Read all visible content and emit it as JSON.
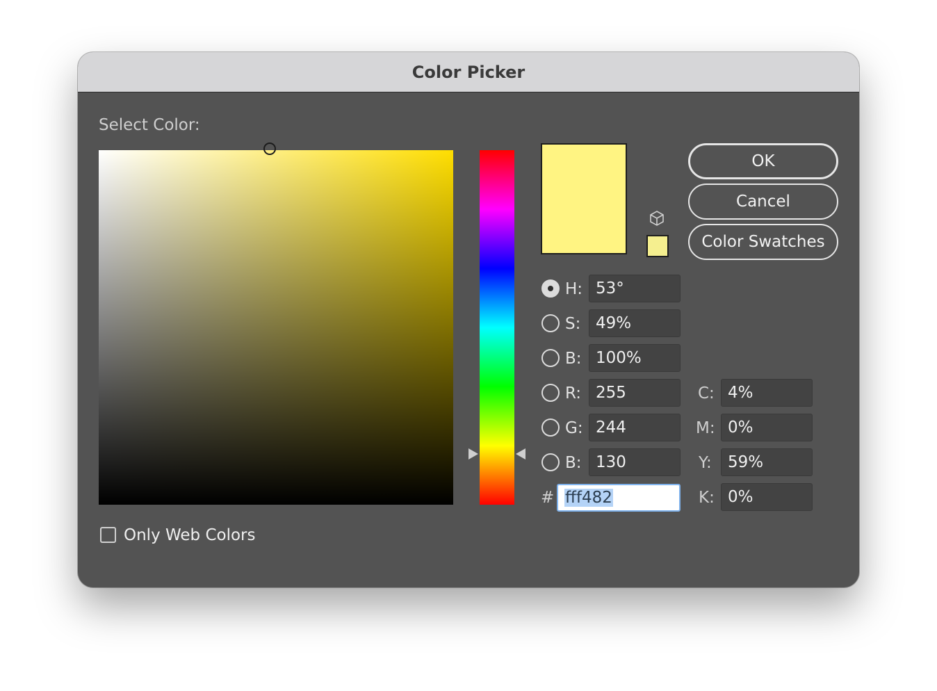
{
  "window": {
    "title": "Color Picker"
  },
  "picker": {
    "select_label": "Select Color:",
    "new_color": "#fff482",
    "current_color": "#f5ef8f",
    "field_hue_color": "#ffde00"
  },
  "buttons": {
    "ok": "OK",
    "cancel": "Cancel",
    "swatches": "Color Swatches"
  },
  "hsb": {
    "h": {
      "label": "H:",
      "value": "53°",
      "selected": true
    },
    "s": {
      "label": "S:",
      "value": "49%",
      "selected": false
    },
    "b": {
      "label": "B:",
      "value": "100%",
      "selected": false
    }
  },
  "rgb": {
    "r": {
      "label": "R:",
      "value": "255",
      "selected": false
    },
    "g": {
      "label": "G:",
      "value": "244",
      "selected": false
    },
    "b": {
      "label": "B:",
      "value": "130",
      "selected": false
    }
  },
  "cmyk": {
    "c": {
      "label": "C:",
      "value": "4%"
    },
    "m": {
      "label": "M:",
      "value": "0%"
    },
    "y": {
      "label": "Y:",
      "value": "59%"
    },
    "k": {
      "label": "K:",
      "value": "0%"
    }
  },
  "hex": {
    "prefix": "#",
    "value": "fff482"
  },
  "web_colors": {
    "label": "Only Web Colors",
    "checked": false
  },
  "icons": {
    "gamut": "cube-icon"
  }
}
